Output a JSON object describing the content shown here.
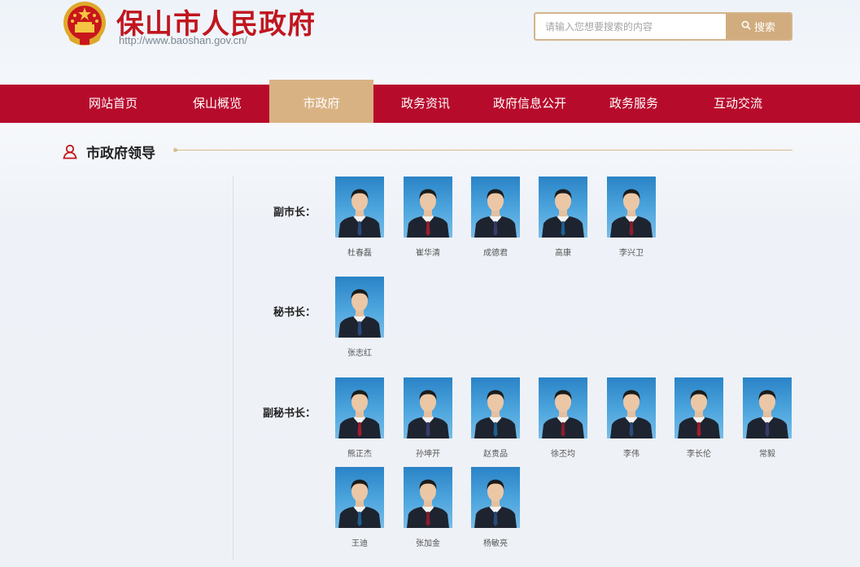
{
  "header": {
    "site_title": "保山市人民政府",
    "site_url": "http://www.baoshan.gov.cn/",
    "search": {
      "placeholder": "请输入您想要搜索的内容",
      "button_label": "搜索",
      "icon": "search-icon"
    }
  },
  "nav": {
    "items": [
      {
        "label": "网站首页",
        "active": false
      },
      {
        "label": "保山概览",
        "active": false
      },
      {
        "label": "市政府",
        "active": true
      },
      {
        "label": "政务资讯",
        "active": false
      },
      {
        "label": "政府信息公开",
        "active": false
      },
      {
        "label": "政务服务",
        "active": false
      },
      {
        "label": "互动交流",
        "active": false
      }
    ]
  },
  "section": {
    "title": "市政府领导",
    "icon": "person-icon"
  },
  "groups": [
    {
      "label": "副市长：",
      "people": [
        "杜春磊",
        "崔华清",
        "成德君",
        "高康",
        "李兴卫"
      ]
    },
    {
      "label": "秘书长：",
      "people": [
        "张志红"
      ]
    },
    {
      "label": "副秘书长：",
      "people": [
        "熊正杰",
        "孙坤开",
        "赵贵品",
        "徐丕均",
        "李伟",
        "李长伦",
        "常毅",
        "王迪",
        "张加金",
        "杨敏亮"
      ]
    }
  ],
  "colors": {
    "brand_red": "#b70b2c",
    "title_red": "#c0161f",
    "active_gold": "#d9b283",
    "accent_gold": "#d1ac7e"
  }
}
